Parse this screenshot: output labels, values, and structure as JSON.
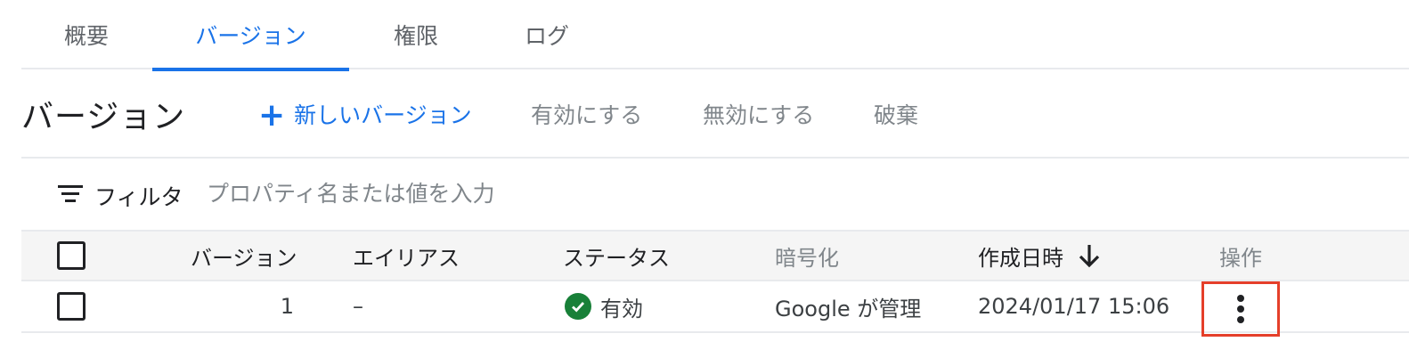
{
  "tabs": [
    {
      "label": "概要",
      "active": false
    },
    {
      "label": "バージョン",
      "active": true
    },
    {
      "label": "権限",
      "active": false
    },
    {
      "label": "ログ",
      "active": false
    }
  ],
  "toolbar": {
    "title": "バージョン",
    "new_version_label": "新しいバージョン",
    "enable_label": "有効にする",
    "disable_label": "無効にする",
    "destroy_label": "破棄"
  },
  "filter": {
    "label": "フィルタ",
    "placeholder": "プロパティ名または値を入力",
    "value": ""
  },
  "table": {
    "columns": {
      "version": "バージョン",
      "alias": "エイリアス",
      "status": "ステータス",
      "encryption": "暗号化",
      "created": "作成日時",
      "actions": "操作"
    },
    "sort": {
      "column": "created",
      "direction": "descending"
    },
    "rows": [
      {
        "version": "1",
        "alias": "–",
        "status": "有効",
        "encryption": "Google が管理",
        "created": "2024/01/17 15:06"
      }
    ]
  },
  "colors": {
    "accent": "#1a73e8",
    "status_ok": "#188038",
    "highlight": "#e53f2a"
  },
  "icons": {
    "new_version": "plus-icon",
    "filter": "filter-list-icon",
    "sort": "arrow-down-icon",
    "status": "check-circle-icon",
    "actions": "more-vert-icon"
  }
}
